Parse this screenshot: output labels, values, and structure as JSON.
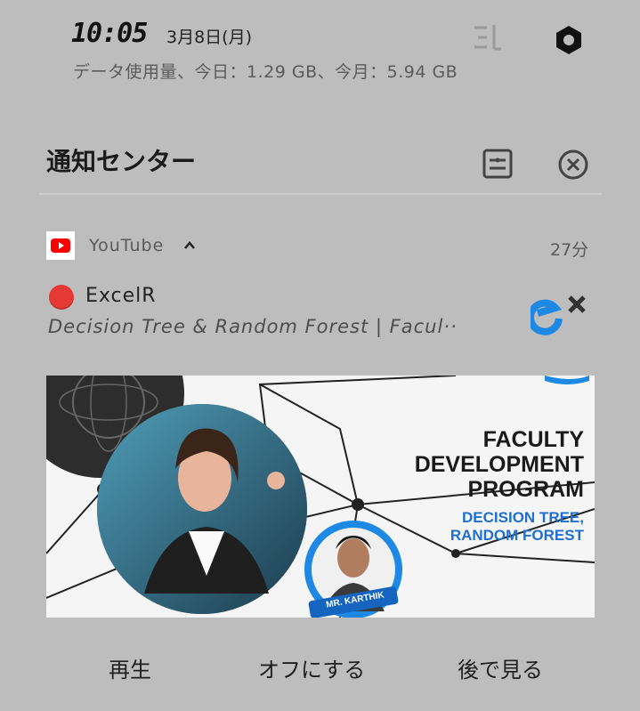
{
  "status_bar": {
    "time": "10:05",
    "date": "3月8日(月)",
    "data_usage": "データ使用量、今日：1.29 GB、今月：5.94 GB"
  },
  "header": {
    "title": "通知センター"
  },
  "notification": {
    "app_name": "YouTube",
    "time": "27分",
    "channel": "ExcelR",
    "description": "Decision Tree & Random Forest | Facul··",
    "thumbnail": {
      "headline_1": "FACULTY",
      "headline_2": "DEVELOPMENT",
      "headline_3": "PROGRAM",
      "subline_1": "DECISION TREE,",
      "subline_2": "RANDOM FOREST",
      "presenter": "MR. KARTHIK"
    },
    "actions": {
      "play": "再生",
      "turn_off": "オフにする",
      "watch_later": "後で見る"
    }
  },
  "colors": {
    "background": "#bdbdbd",
    "youtube_red": "#ff0000",
    "channel_dot": "#e53935",
    "thumb_accent": "#1e88e5"
  },
  "icons": [
    "edit-icon",
    "settings-icon",
    "manage-notifications-icon",
    "clear-all-icon",
    "youtube-icon",
    "chevron-up-icon",
    "excelr-logo-icon"
  ]
}
